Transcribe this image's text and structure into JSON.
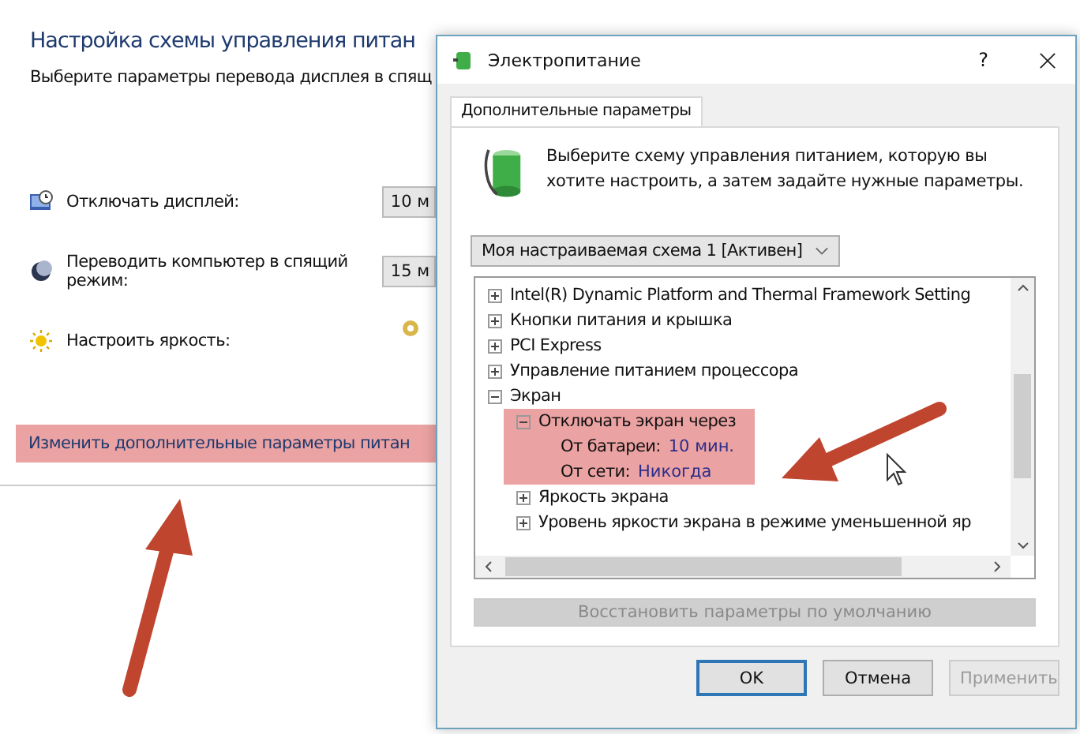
{
  "page": {
    "title": "Настройка схемы управления питан",
    "subtitle": "Выберите параметры перевода дисплея в спящ",
    "settings": [
      {
        "kind": "display",
        "label": "Отключать дисплей:",
        "value": "10 м"
      },
      {
        "kind": "sleep",
        "label": "Переводить компьютер в спящий режим:",
        "value": "15 м"
      },
      {
        "kind": "brightness",
        "label": "Настроить яркость:"
      }
    ],
    "link": {
      "text": "Изменить дополнительные параметры питан",
      "highlighted": true
    }
  },
  "dialog": {
    "title": "Электропитание",
    "help": "?",
    "tabs": [
      {
        "label": "Дополнительные параметры",
        "selected": true
      }
    ],
    "intro": "Выберите схему управления питанием, которую вы хотите настроить, а затем задайте нужные параметры.",
    "scheme": "Моя настраиваемая схема 1 [Активен]",
    "tree": [
      {
        "label": "Intel(R) Dynamic Platform and Thermal Framework Setting",
        "expanded": false
      },
      {
        "label": "Кнопки питания и крышка",
        "expanded": false
      },
      {
        "label": "PCI Express",
        "expanded": false
      },
      {
        "label": "Управление питанием процессора",
        "expanded": false
      },
      {
        "label": "Экран",
        "expanded": true,
        "children": [
          {
            "label": "Отключать экран через",
            "expanded": true,
            "highlighted": true,
            "values": [
              {
                "label": "От батареи:",
                "value": "10 мин."
              },
              {
                "label": "От сети:",
                "value": "Никогда"
              }
            ]
          },
          {
            "label": "Яркость экрана",
            "expanded": false
          },
          {
            "label": "Уровень яркости экрана в режиме уменьшенной яр",
            "expanded": false
          }
        ]
      }
    ],
    "restore": {
      "label": "Восстановить параметры по умолчанию",
      "disabled": true
    },
    "buttons": [
      {
        "label": "OK",
        "default": true,
        "disabled": false
      },
      {
        "label": "Отмена",
        "default": false,
        "disabled": false
      },
      {
        "label": "Применить",
        "default": false,
        "disabled": true
      }
    ]
  }
}
